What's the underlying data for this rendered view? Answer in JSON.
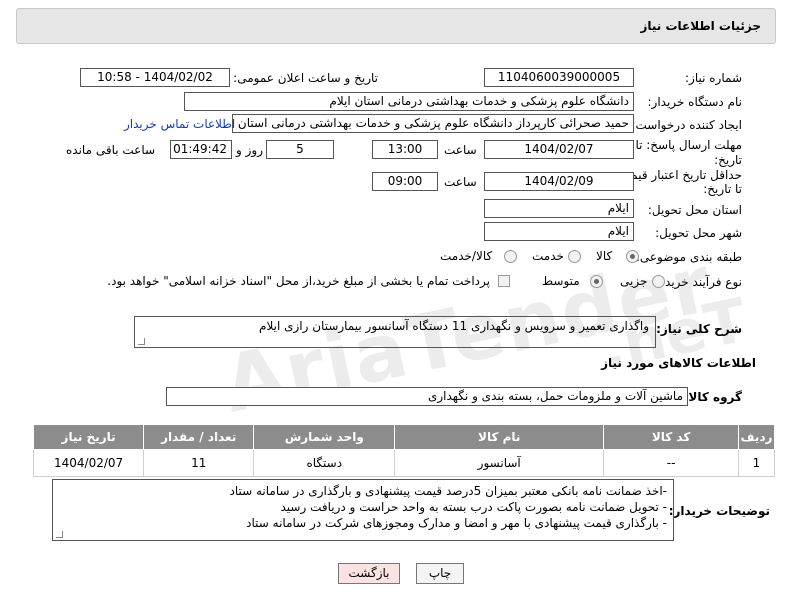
{
  "header": {
    "title": "جزئیات اطلاعات نیاز"
  },
  "watermark": {
    "text": "AriaTender",
    "suffix": ".neT"
  },
  "fields": {
    "need_number_label": "شماره نیاز:",
    "need_number": "1104060039000005",
    "announce_label": "تاریخ و ساعت اعلان عمومی:",
    "announce_value": "1404/02/02 - 10:58",
    "buyer_org_label": "نام دستگاه خریدار:",
    "buyer_org": "دانشگاه علوم پزشکی و خدمات بهداشتی درمانی استان ایلام",
    "creator_label": "ایجاد کننده درخواست:",
    "creator": "حمید صحرائی کارپرداز دانشگاه علوم پزشکی و خدمات بهداشتی درمانی استان",
    "contact_link": "اطلاعات تماس خریدار",
    "deadline_label_1": "مهلت ارسال پاسخ: تا",
    "deadline_label_2": "تاریخ:",
    "deadline_date": "1404/02/07",
    "time_label": "ساعت",
    "deadline_time": "13:00",
    "days_value": "5",
    "days_label": "روز و",
    "remaining_time": "01:49:42",
    "remaining_label": "ساعت باقی مانده",
    "validity_label_1": "حداقل تاریخ اعتبار قیمت:",
    "validity_label_2": "تا تاریخ:",
    "validity_date": "1404/02/09",
    "validity_time_label": "ساعت",
    "validity_time": "09:00",
    "province_label": "استان محل تحویل:",
    "province": "ایلام",
    "city_label": "شهر محل تحویل:",
    "city": "ایلام",
    "category_label": "طبقه بندی موضوعی:",
    "category_options": [
      "کالا",
      "خدمت",
      "کالا/خدمت"
    ],
    "process_label": "نوع فرآیند خرید :",
    "process_options": [
      "جزیی",
      "متوسط"
    ],
    "payment_note": "پرداخت تمام یا بخشی از مبلغ خرید،از محل \"اسناد خزانه اسلامی\" خواهد بود.",
    "summary_label": "شرح کلی نیاز:",
    "summary": "واگذاری تعمیر و سرویس و نگهداری 11 دستگاه آسانسور بیمارستان رازی ایلام",
    "goods_info_title": "اطلاعات کالاهای مورد نیاز",
    "goods_group_label": "گروه کالا:",
    "goods_group": "ماشین آلات و ملزومات حمل، بسته بندی و نگهداری"
  },
  "table": {
    "headers": [
      "ردیف",
      "کد کالا",
      "نام کالا",
      "واحد شمارش",
      "تعداد / مقدار",
      "تاریخ نیاز"
    ],
    "rows": [
      [
        "1",
        "--",
        "آسانسور",
        "دستگاه",
        "11",
        "1404/02/07"
      ]
    ]
  },
  "notes": {
    "label": "توضیحات خریدار:",
    "lines": [
      "-اخذ ضمانت نامه بانکی معتبر بمیزان 5درصد قیمت پیشنهادی و بارگذاری در سامانه ستاد",
      "- تحویل ضمانت نامه بصورت پاکت درب بسته به واحد حراست و دریافت رسید",
      "- بارگذاری قیمت پیشنهادی با مهر و امضا و مدارک ومجوزهای شرکت در سامانه ستاد"
    ]
  },
  "buttons": {
    "print": "چاپ",
    "back": "بازگشت"
  },
  "colors": {
    "header_bg": "#e6e6e6",
    "table_header_bg": "#8c8c8c",
    "link": "#1a3ea8",
    "back_button_bg": "#fbe3e3"
  }
}
